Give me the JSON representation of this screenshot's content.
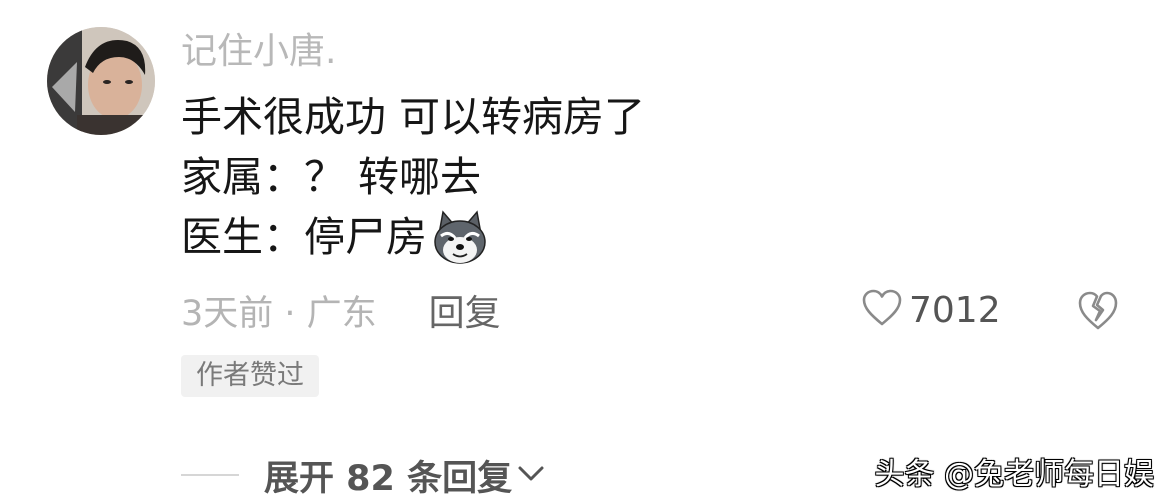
{
  "comment": {
    "username": "记住小唐.",
    "lines": [
      "手术很成功 可以转病房了",
      "家属：？ 转哪去",
      "医生：停尸房"
    ],
    "emoji": "dog-emoji-icon",
    "time_location": "3天前 · 广东",
    "reply_label": "回复",
    "like_count": "7012",
    "author_badge": "作者赞过",
    "expand_label": "展开 82 条回复"
  },
  "watermark": "头条 @兔老师每日娱",
  "colors": {
    "username": "#b8b8b8",
    "text": "#161616",
    "meta": "#b4b4b4",
    "badge_bg": "#f1f1f1"
  }
}
